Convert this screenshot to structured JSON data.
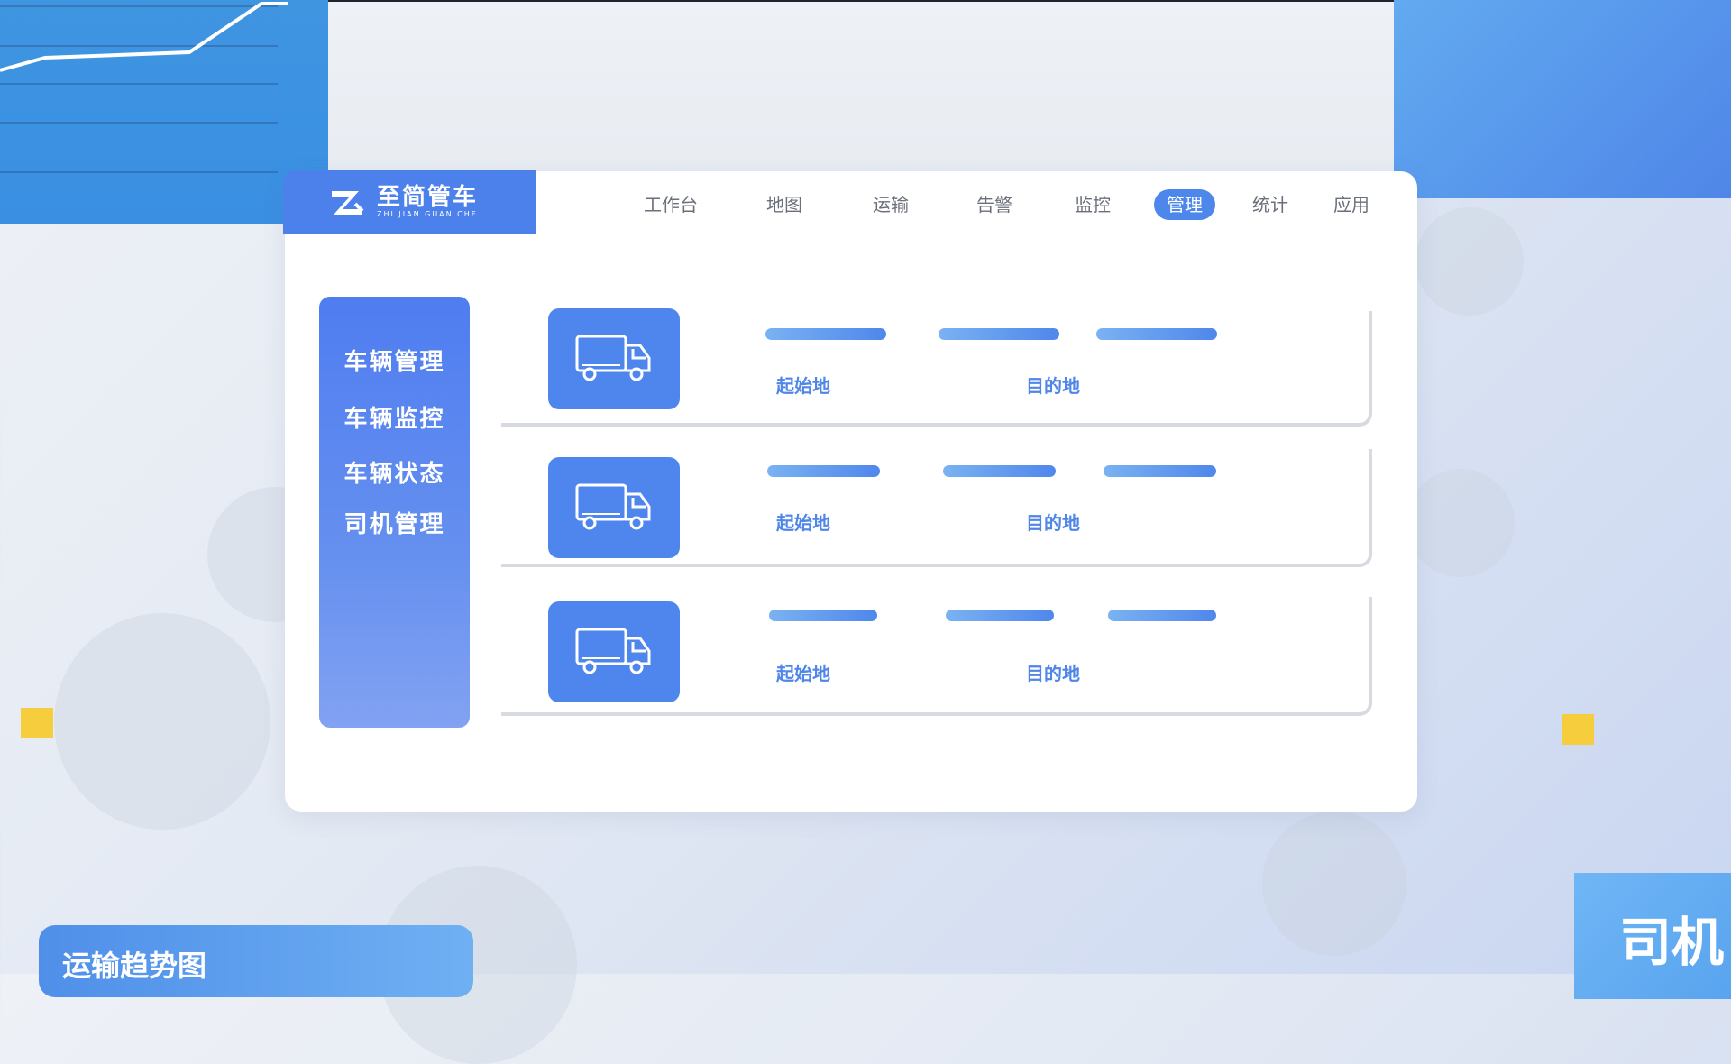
{
  "brand": {
    "name_cn": "至简管车",
    "name_en": "ZHI JIAN GUAN CHE"
  },
  "nav": [
    {
      "label": "工作台"
    },
    {
      "label": "地图"
    },
    {
      "label": "运输"
    },
    {
      "label": "告警"
    },
    {
      "label": "监控"
    },
    {
      "label": "管理",
      "active": true
    },
    {
      "label": "统计"
    },
    {
      "label": "应用"
    }
  ],
  "sidebar": {
    "items": [
      {
        "label": "车辆管理"
      },
      {
        "label": "车辆监控"
      },
      {
        "label": "车辆状态"
      },
      {
        "label": "司机管理"
      }
    ]
  },
  "rows": [
    {
      "icon": "truck-icon",
      "origin_label": "起始地",
      "destination_label": "目的地"
    },
    {
      "icon": "truck-icon",
      "origin_label": "起始地",
      "destination_label": "目的地"
    },
    {
      "icon": "truck-icon",
      "origin_label": "起始地",
      "destination_label": "目的地"
    }
  ],
  "cards": {
    "bottom_left_title": "运输趋势图",
    "bottom_right_title": "司机"
  },
  "colors": {
    "accent": "#4c80ea",
    "highlight": "#f6cd3c"
  }
}
